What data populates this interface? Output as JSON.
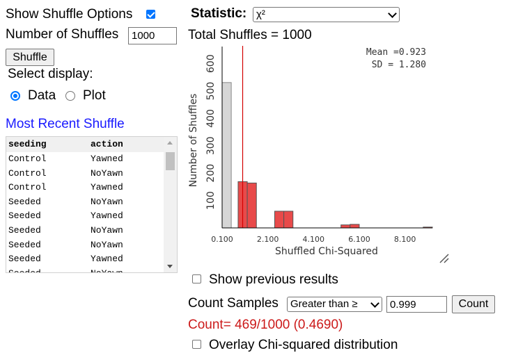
{
  "left": {
    "show_shuffle_label": "Show Shuffle Options",
    "show_shuffle_checked": true,
    "num_shuffles_label": "Number of Shuffles",
    "num_shuffles_value": "1000",
    "shuffle_button": "Shuffle",
    "select_display_label": "Select display:",
    "display_options": [
      "Data",
      "Plot"
    ],
    "display_selected": "Data",
    "recent_title": "Most Recent Shuffle",
    "table": {
      "columns": [
        "seeding",
        "action"
      ],
      "rows": [
        [
          "Control",
          "Yawned"
        ],
        [
          "Control",
          "NoYawn"
        ],
        [
          "Control",
          "Yawned"
        ],
        [
          "Seeded",
          "NoYawn"
        ],
        [
          "Seeded",
          "Yawned"
        ],
        [
          "Seeded",
          "NoYawn"
        ],
        [
          "Seeded",
          "NoYawn"
        ],
        [
          "Seeded",
          "Yawned"
        ],
        [
          "Seeded",
          "NoYawn"
        ]
      ]
    }
  },
  "right": {
    "statistic_label": "Statistic:",
    "statistic_value": "χ²",
    "total_shuffles": "Total Shuffles = 1000",
    "mean_text": "Mean =0.923",
    "sd_text": "SD = 1.280",
    "show_previous_label": "Show previous results",
    "count_samples_label": "Count Samples",
    "count_direction": "Greater than ≥",
    "count_value": "0.999",
    "count_button": "Count",
    "count_result": "Count= 469/1000 (0.4690)",
    "overlay_label": "Overlay Chi-squared distribution"
  },
  "colors": {
    "accent": "#0075ff",
    "link_blue": "#1a1aff",
    "count_red": "#cc1a1a",
    "bar_red": "#e84a4a",
    "bar_gray": "#d6d6d6",
    "stat_line": "#d40000"
  },
  "chart_data": {
    "type": "bar",
    "xlabel": "Shuffled Chi-Squared",
    "ylabel": "Number of Shuffles",
    "x_ticks": [
      "0.100",
      "2.100",
      "4.100",
      "6.100",
      "8.100"
    ],
    "y_ticks": [
      "100",
      "200",
      "300",
      "400",
      "500",
      "600"
    ],
    "xlim": [
      0.1,
      9.3
    ],
    "ylim": [
      0,
      660
    ],
    "observed_statistic": 0.999,
    "bins": [
      {
        "x0": 0.1,
        "x1": 0.5,
        "count": 531,
        "counted": false
      },
      {
        "x0": 0.8,
        "x1": 1.2,
        "count": 169,
        "counted": true
      },
      {
        "x0": 1.2,
        "x1": 1.6,
        "count": 164,
        "counted": true
      },
      {
        "x0": 2.4,
        "x1": 2.8,
        "count": 61,
        "counted": true
      },
      {
        "x0": 2.8,
        "x1": 3.2,
        "count": 61,
        "counted": true
      },
      {
        "x0": 5.3,
        "x1": 5.7,
        "count": 11,
        "counted": true
      },
      {
        "x0": 5.7,
        "x1": 6.1,
        "count": 13,
        "counted": true
      },
      {
        "x0": 8.9,
        "x1": 9.3,
        "count": 3,
        "counted": true
      }
    ]
  }
}
